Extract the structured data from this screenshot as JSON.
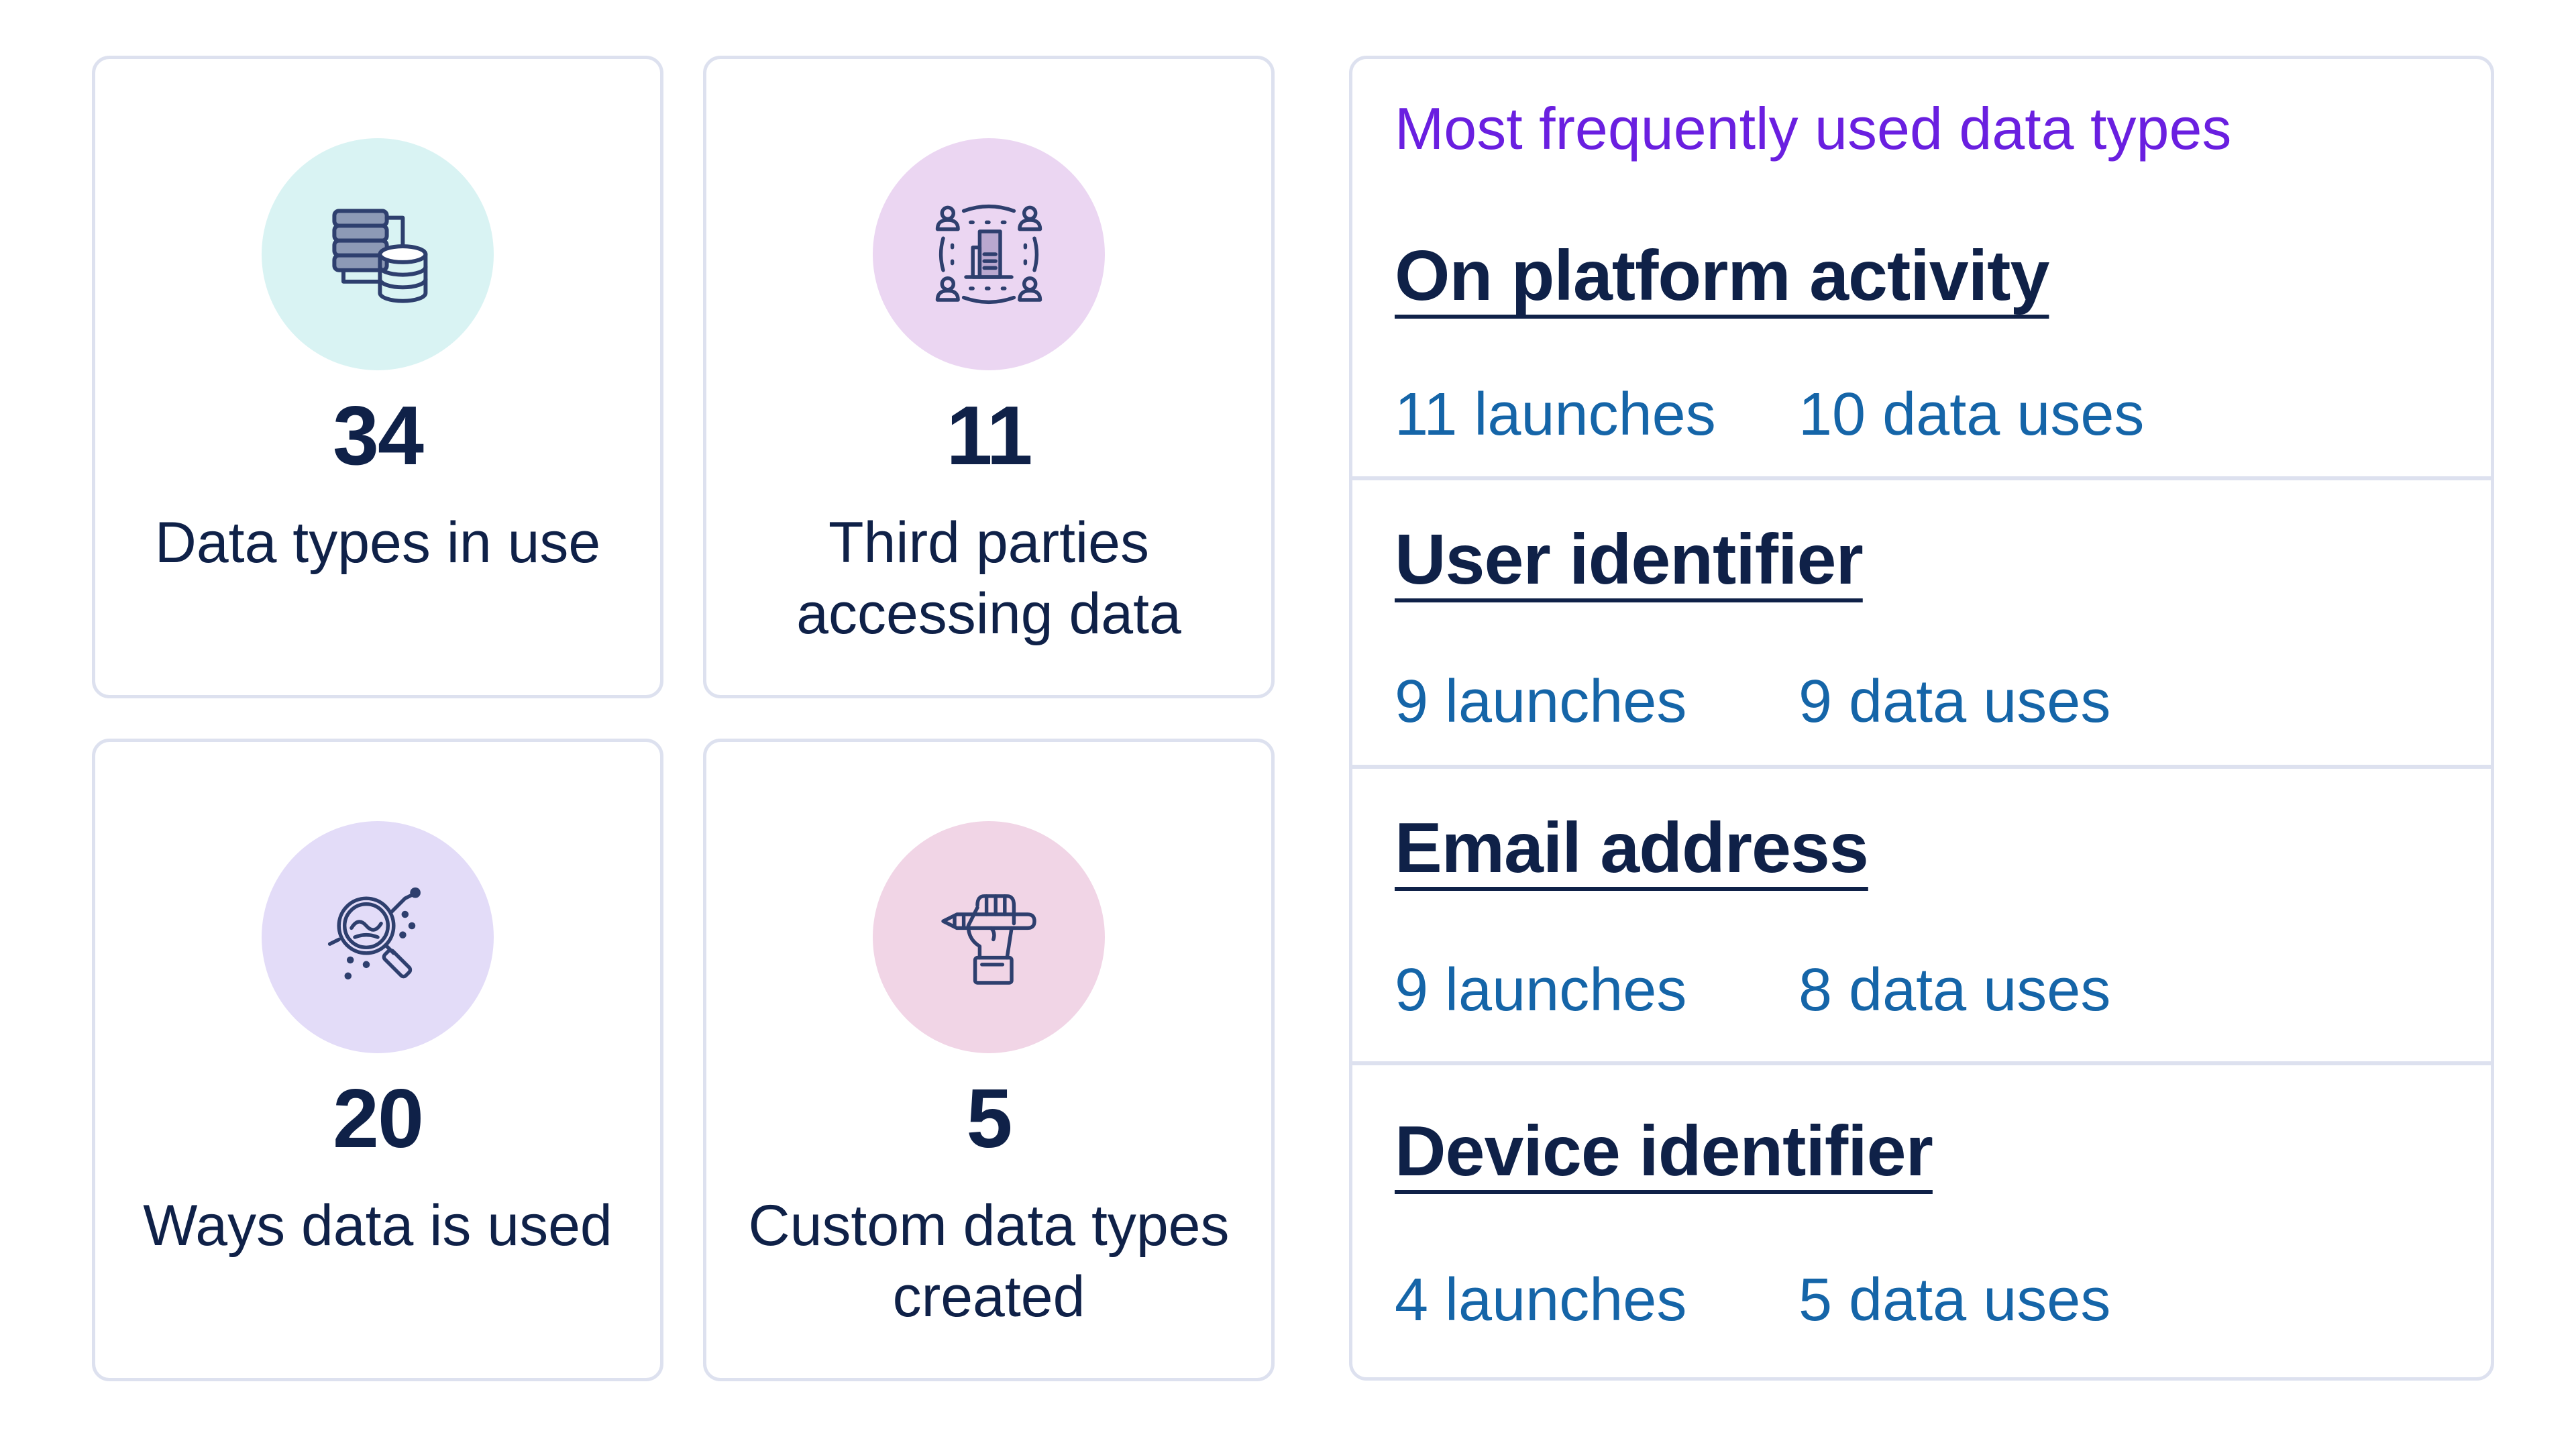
{
  "stats_cards": [
    {
      "value": "34",
      "label": "Data types in use",
      "icon": "database-server-icon",
      "circle_color": "#d9f3f3"
    },
    {
      "value": "11",
      "label": "Third parties accessing data",
      "icon": "third-parties-network-icon",
      "circle_color": "#ebd6f2"
    },
    {
      "value": "20",
      "label": "Ways data is used",
      "icon": "data-analysis-magnifier-icon",
      "circle_color": "#e3dcf8"
    },
    {
      "value": "5",
      "label": "Custom data types created",
      "icon": "hand-holding-pencil-icon",
      "circle_color": "#f1d5e6"
    }
  ],
  "frequent_types": {
    "title": "Most frequently used data types",
    "items": [
      {
        "name": "On platform activity",
        "launches": "11 launches",
        "data_uses": "10 data uses"
      },
      {
        "name": "User identifier",
        "launches": "9 launches",
        "data_uses": "9 data uses"
      },
      {
        "name": "Email address",
        "launches": "9 launches",
        "data_uses": "8 data uses"
      },
      {
        "name": "Device identifier",
        "launches": "4 launches",
        "data_uses": "5 data uses"
      }
    ]
  },
  "colors": {
    "heading_text": "#0f2148",
    "accent_purple": "#6a1fe0",
    "link_blue": "#1565a8",
    "border": "#dde1ef",
    "icon_stroke": "#2e3f6e"
  }
}
